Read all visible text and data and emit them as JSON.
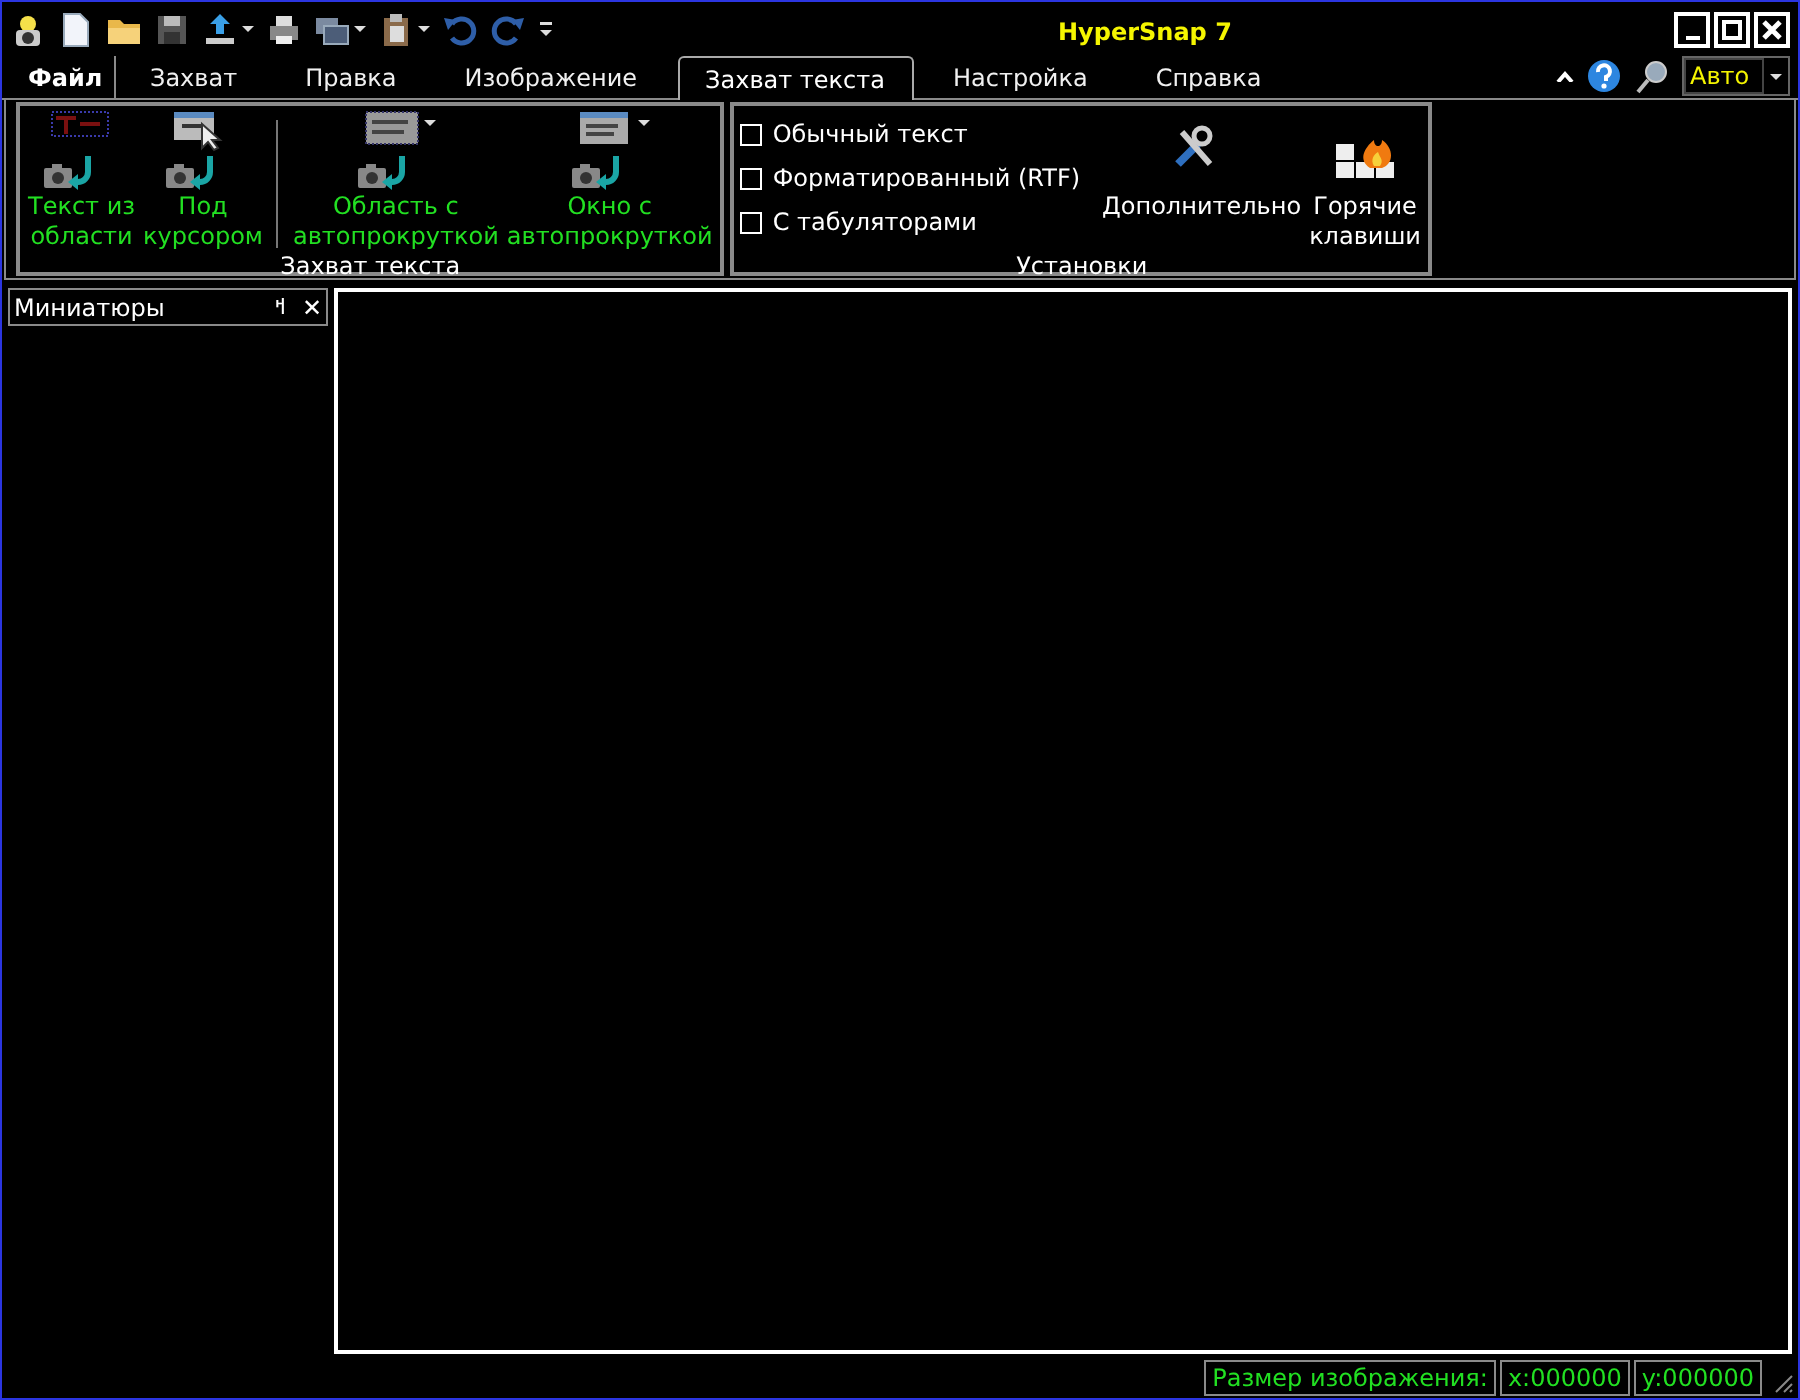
{
  "window": {
    "title": "HyperSnap 7"
  },
  "quick_access": [
    {
      "kind": "new"
    },
    {
      "kind": "open"
    },
    {
      "kind": "save"
    },
    {
      "kind": "upload",
      "dropdown": true
    },
    {
      "kind": "print"
    },
    {
      "kind": "windows",
      "dropdown": true
    },
    {
      "kind": "clipboard",
      "dropdown": true
    },
    {
      "kind": "undo"
    },
    {
      "kind": "redo"
    },
    {
      "kind": "customize"
    }
  ],
  "tabs": [
    {
      "label": "Файл",
      "kind": "file",
      "selected": false
    },
    {
      "label": "Захват",
      "kind": "tab",
      "selected": false
    },
    {
      "label": "Правка",
      "kind": "tab",
      "selected": false
    },
    {
      "label": "Изображение",
      "kind": "tab",
      "selected": false
    },
    {
      "label": "Захват текста",
      "kind": "tab",
      "selected": true
    },
    {
      "label": "Настройка",
      "kind": "tab",
      "selected": false
    },
    {
      "label": "Справка",
      "kind": "tab",
      "selected": false
    }
  ],
  "zoom_combo": {
    "value": "Авто"
  },
  "ribbon_groups": [
    {
      "label": "Захват текста",
      "items": [
        {
          "kind": "button",
          "label": "Текст из\nобласти"
        },
        {
          "kind": "button",
          "label": "Под\nкурсором"
        },
        {
          "kind": "separator"
        },
        {
          "kind": "button",
          "label": "Область с\nавтопрокруткой",
          "dropdown": true
        },
        {
          "kind": "button",
          "label": "Окно с\nавтопрокруткой",
          "dropdown": true
        }
      ]
    },
    {
      "label": "Установки",
      "items": [
        {
          "kind": "checkboxes",
          "options": [
            {
              "label": "Обычный текст",
              "checked": false
            },
            {
              "label": "Форматированный (RTF)",
              "checked": false
            },
            {
              "label": "С табуляторами",
              "checked": false
            }
          ]
        },
        {
          "kind": "button",
          "label": "Дополнительно"
        },
        {
          "kind": "button",
          "label": "Горячие\nклавиши"
        }
      ]
    }
  ],
  "thumbnails_panel": {
    "title": "Миниатюры",
    "pin_glyph": "ߞ",
    "close_glyph": "✕"
  },
  "status_bar": [
    "Размер изображения:",
    "x:000000",
    "y:000000"
  ]
}
